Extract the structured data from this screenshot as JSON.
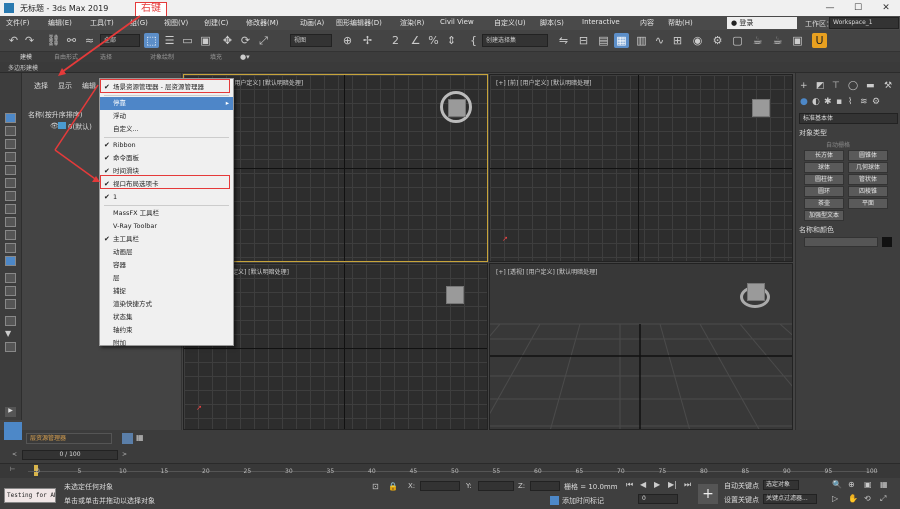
{
  "titlebar": {
    "title": "无标题 - 3ds Max 2019"
  },
  "annotation": {
    "right_click": "右键"
  },
  "menu": [
    "文件(F)",
    "编辑(E)",
    "工具(T)",
    "组(G)",
    "视图(V)",
    "创建(C)",
    "修改器(M)",
    "动画(A)",
    "图形编辑器(D)",
    "渲染(R)",
    "Civil View",
    "自定义(U)",
    "脚本(S)",
    "Interactive",
    "内容",
    "帮助(H)"
  ],
  "menu_right": {
    "login": "登录",
    "workspace_label": "工作区：",
    "workspace_value": "Workspace_1"
  },
  "toolbar": {
    "filter": "全部",
    "ref_coord": "视图",
    "selection_set": "创建选择集"
  },
  "ribbon": {
    "tabs": [
      "建模",
      "自由形式",
      "选择",
      "对象绘制",
      "填充"
    ],
    "sub": "多边形建模"
  },
  "explorer": {
    "tabs": [
      "选择",
      "显示",
      "编辑"
    ],
    "column": "名称(按升序排序)",
    "item": "0(默认)"
  },
  "context_menu": {
    "items": [
      {
        "label": "场景资源管理器 - 层资源管理器",
        "checked": true,
        "highlight": false
      },
      {
        "label": "停靠",
        "checked": false,
        "highlight": true,
        "submenu": true
      },
      {
        "label": "浮动",
        "checked": false,
        "highlight": false
      },
      {
        "label": "自定义...",
        "checked": false,
        "highlight": false
      },
      {
        "label": "Ribbon",
        "checked": true,
        "highlight": false
      },
      {
        "label": "命令面板",
        "checked": true,
        "highlight": false
      },
      {
        "label": "时间滑块",
        "checked": true,
        "highlight": false
      },
      {
        "label": "视口布局选项卡",
        "checked": true,
        "highlight": false
      },
      {
        "label": "1",
        "checked": true,
        "highlight": false
      },
      {
        "label": "MassFX 工具栏",
        "checked": false,
        "highlight": false
      },
      {
        "label": "V-Ray Toolbar",
        "checked": false,
        "highlight": false
      },
      {
        "label": "主工具栏",
        "checked": true,
        "highlight": false
      },
      {
        "label": "动画层",
        "checked": false,
        "highlight": false
      },
      {
        "label": "容器",
        "checked": false,
        "highlight": false
      },
      {
        "label": "层",
        "checked": false,
        "highlight": false
      },
      {
        "label": "捕捉",
        "checked": false,
        "highlight": false
      },
      {
        "label": "渲染快捷方式",
        "checked": false,
        "highlight": false
      },
      {
        "label": "状态集",
        "checked": false,
        "highlight": false
      },
      {
        "label": "轴约束",
        "checked": false,
        "highlight": false
      },
      {
        "label": "附加",
        "checked": false,
        "highlight": false
      }
    ]
  },
  "viewports": {
    "top": "[+] [顶] [用户定义] [默认明暗处理]",
    "top_short": "[用户定义] [默认明暗处理]",
    "front": "[+] [前] [用户定义] [默认明暗处理]",
    "left": "[+] [左] [用户定义] [默认明暗处理]",
    "left_short": "定义] [默认明暗处理]",
    "persp": "[+] [透视] [用户定义] [默认明暗处理]"
  },
  "command_panel": {
    "dropdown": "标准基本体",
    "section1": "对象类型",
    "autogrid": "自动栅格",
    "buttons": [
      "长方体",
      "圆锥体",
      "球体",
      "几何球体",
      "圆柱体",
      "管状体",
      "圆环",
      "四棱锥",
      "茶壶",
      "平面",
      "加强型文本"
    ],
    "section2": "名称和颜色"
  },
  "bottom": {
    "layer_dropdown": "层资源管理器",
    "frame": "0 / 100",
    "script_label": "Testing for AD:",
    "status1": "未选定任何对象",
    "status2": "单击或单击并拖动以选择对象",
    "x": "X: ",
    "y": "Y: ",
    "z": "Z: ",
    "grid": "栅格 = 10.0mm",
    "add_time_tag": "添加时间标记",
    "auto_key": "自动关键点",
    "set_key": "设置关键点",
    "selected": "选定对象",
    "key_filter": "关键点过滤器...",
    "frame_field": "0"
  },
  "timeline_ticks": [
    "0",
    "5",
    "10",
    "15",
    "20",
    "25",
    "30",
    "35",
    "40",
    "45",
    "50",
    "55",
    "60",
    "65",
    "70",
    "75",
    "80",
    "85",
    "90",
    "95",
    "100"
  ]
}
